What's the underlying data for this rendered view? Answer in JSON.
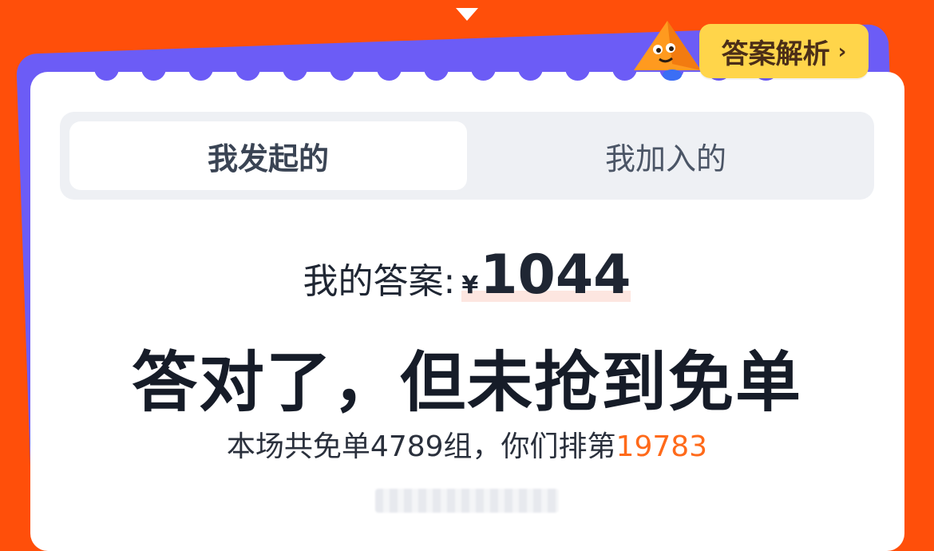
{
  "colors": {
    "background": "#ff4f0a",
    "card_shadow": "#6c5cf6",
    "accent_yellow": "#ffd54a",
    "rank_highlight": "#ff6a1a"
  },
  "header": {
    "analysis_button_label": "答案解析",
    "analysis_chevron": "›"
  },
  "tabs": [
    {
      "label": "我发起的",
      "active": true
    },
    {
      "label": "我加入的",
      "active": false
    }
  ],
  "answer": {
    "label": "我的答案:",
    "currency": "¥",
    "amount": "1044"
  },
  "result": {
    "title": "答对了，但未抢到免单"
  },
  "rank": {
    "prefix": "本场共免单4789组，你们排第",
    "number": "19783"
  }
}
